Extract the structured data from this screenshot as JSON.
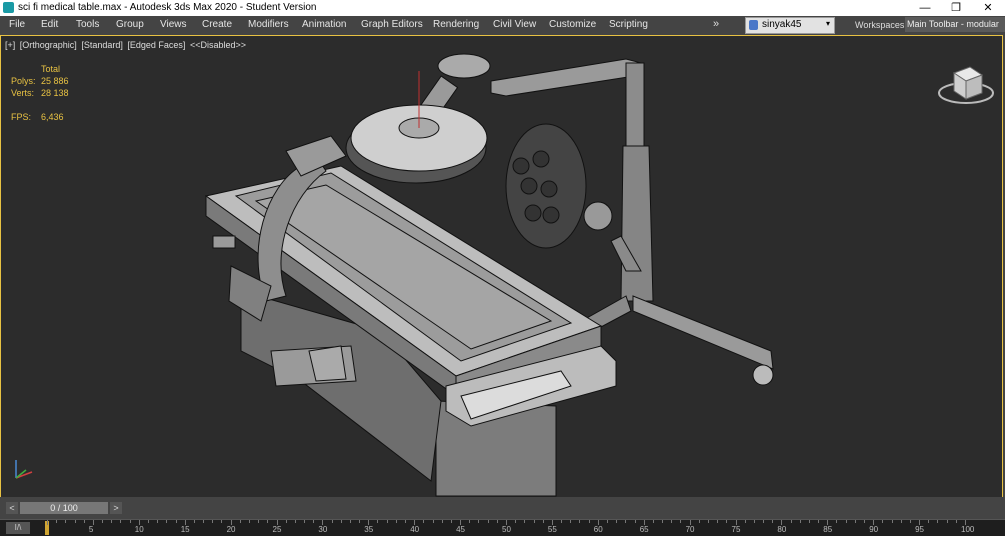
{
  "window": {
    "title": "sci fi medical table.max - Autodesk 3ds Max 2020 - Student Version",
    "minimize": "—",
    "maximize": "❐",
    "close": "✕"
  },
  "menu": [
    "File",
    "Edit",
    "Tools",
    "Group",
    "Views",
    "Create",
    "Modifiers",
    "Animation",
    "Graph Editors",
    "Rendering",
    "Civil View",
    "Customize",
    "Scripting"
  ],
  "menu_more": "»",
  "user": {
    "name": "sinyak45",
    "caret": "▾"
  },
  "workspaces": {
    "label": "Workspaces:",
    "value": "Main Toolbar - modular"
  },
  "viewport": {
    "labels": [
      "[+]",
      "[Orthographic]",
      "[Standard]",
      "[Edged Faces]",
      "<<Disabled>>"
    ],
    "stats": {
      "header": "Total",
      "polys_label": "Polys:",
      "polys": "25 886",
      "verts_label": "Verts:",
      "verts": "28 138",
      "fps_label": "FPS:",
      "fps": "6,436"
    },
    "accent": "#e8c243"
  },
  "timeline": {
    "prev": "<",
    "next": ">",
    "slider": "0 / 100",
    "key_icon": "I/\\",
    "ticks": [
      "0",
      "5",
      "10",
      "15",
      "20",
      "25",
      "30",
      "35",
      "40",
      "45",
      "50",
      "55",
      "60",
      "65",
      "70",
      "75",
      "80",
      "85",
      "90",
      "95",
      "100"
    ]
  }
}
